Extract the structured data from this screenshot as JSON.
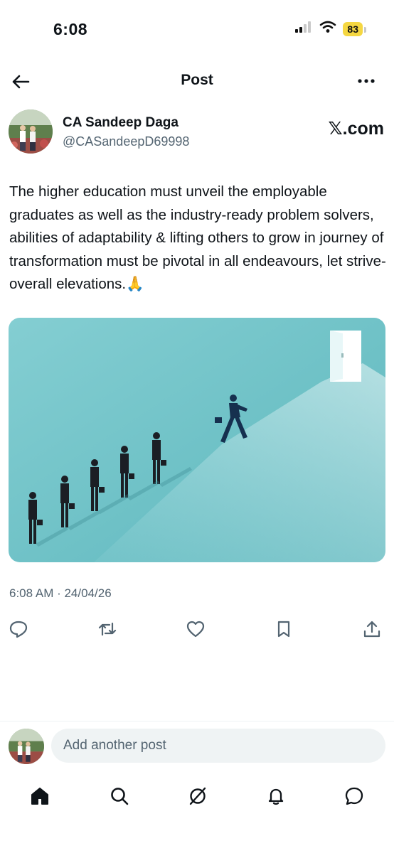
{
  "status_bar": {
    "time": "6:08",
    "battery": "83",
    "icons": [
      "signal-icon",
      "wifi-icon",
      "battery-icon"
    ]
  },
  "header": {
    "title": "Post",
    "back_icon": "back-arrow-icon",
    "more_icon": "more-icon"
  },
  "post": {
    "author_name": "CA Sandeep Daga",
    "author_handle": "@CASandeepD69998",
    "source_label": "𝕏.com",
    "text": "The higher education must unveil the employable graduates as well as the industry-ready problem solvers, abilities of adaptability & lifting others to grow in journey of transformation must be pivotal in all endeavours, let strive-overall elevations.🙏",
    "timestamp": "6:08 AM · 24/04/26",
    "image_icon": "illustration-people-walking-toward-door"
  },
  "actions": [
    "reply-icon",
    "repost-icon",
    "like-icon",
    "bookmark-icon",
    "share-icon"
  ],
  "composer": {
    "placeholder": "Add another post"
  },
  "bottom_nav": [
    "home-icon",
    "search-icon",
    "grok-icon",
    "notifications-icon",
    "messages-icon"
  ],
  "colors": {
    "text": "#0f1419",
    "secondary": "#536471",
    "battery": "#f5d742",
    "image_bg": "#73c7cc"
  }
}
